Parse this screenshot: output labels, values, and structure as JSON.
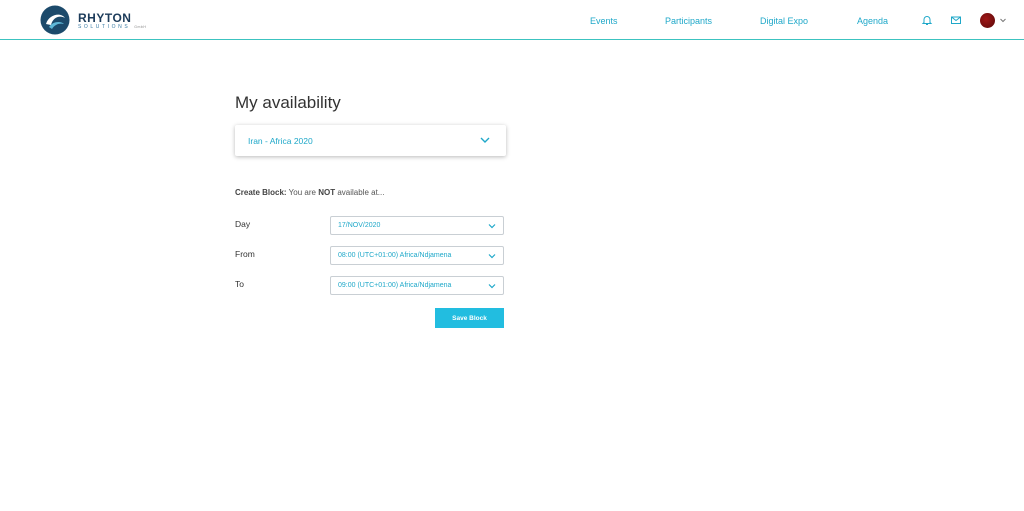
{
  "brand": {
    "name": "RHYTON",
    "subtitle": "SOLUTIONS",
    "suffix": "GmbH"
  },
  "nav": {
    "links": [
      "Events",
      "Participants",
      "Digital Expo",
      "Agenda"
    ],
    "icons": [
      "bell-icon",
      "mail-icon"
    ],
    "accent_color": "#1fa8c9"
  },
  "page": {
    "title": "My availability",
    "event_select": {
      "value": "Iran - Africa 2020"
    },
    "create_block": {
      "label": "Create Block:",
      "text_before": "You are",
      "emphasis": "NOT",
      "text_after": "available at..."
    },
    "fields": {
      "day": {
        "label": "Day",
        "value": "17/NOV/2020"
      },
      "from": {
        "label": "From",
        "value": "08:00 (UTC+01:00) Africa/Ndjamena"
      },
      "to": {
        "label": "To",
        "value": "09:00 (UTC+01:00) Africa/Ndjamena"
      }
    },
    "save_button": "Save Block",
    "button_color": "#22bde0"
  }
}
